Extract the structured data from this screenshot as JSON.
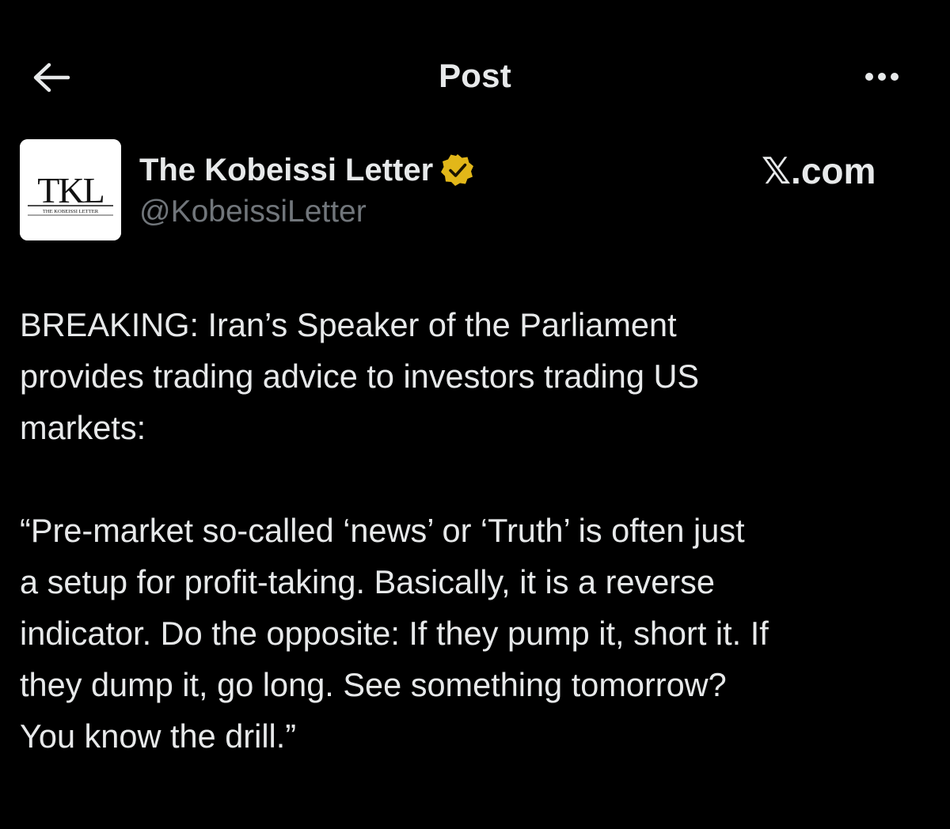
{
  "header": {
    "title": "Post",
    "back_icon": "arrow-left-icon",
    "more_icon": "more-horizontal-icon"
  },
  "author": {
    "name": "The Kobeissi Letter",
    "handle": "@KobeissiLetter",
    "verified_icon": "verified-badge-icon",
    "verified_color": "#e2b719",
    "avatar": {
      "logo_text": "TKL",
      "logo_subtext": "THE KOBEISSI LETTER"
    }
  },
  "watermark": {
    "text": "𝕏.com"
  },
  "post": {
    "line1": "BREAKING: Iran’s Speaker of the Parliament",
    "line2": "provides trading advice to investors trading US",
    "line3": "markets:",
    "q1": "“Pre-market so-called ‘news’ or ‘Truth’ is often just",
    "q2": "a setup for profit-taking. Basically, it is a reverse",
    "q3": "indicator. Do the opposite: If they pump it, short it. If",
    "q4": "they dump it, go long. See something tomorrow?",
    "q5": "You know the drill.”"
  },
  "colors": {
    "background": "#000000",
    "text_primary": "#e7e9ea",
    "text_secondary": "#71767b"
  }
}
